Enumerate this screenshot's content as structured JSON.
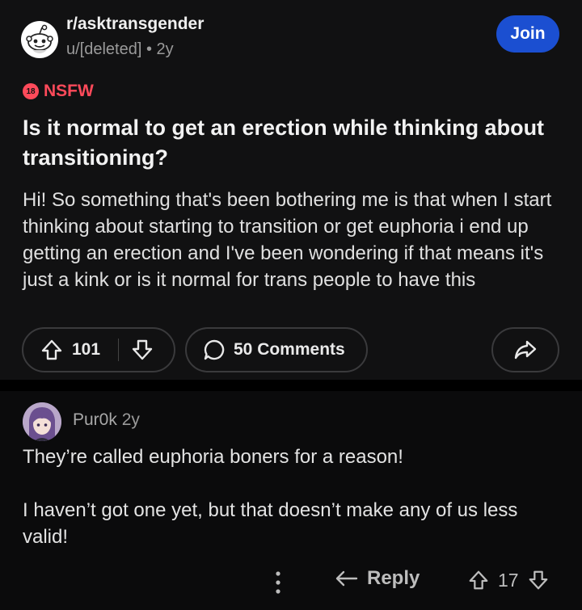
{
  "post": {
    "subreddit": "r/asktransgender",
    "author_meta": "u/[deleted] • 2y",
    "join_label": "Join",
    "nsfw_badge_icon_text": "18",
    "nsfw_label": "NSFW",
    "title": "Is it normal to get an erection while thinking about transitioning?",
    "body": "Hi! So something that's been bothering me is that when I start thinking about starting to transition or get euphoria i end up getting an erection and I've been wondering if that means it's just a kink or is it normal for trans people to have this",
    "upvotes": "101",
    "comments_label": "50 Comments",
    "icons": {
      "subreddit_avatar": "reddit-snoo-icon",
      "upvote": "arrow-up-icon",
      "downvote": "arrow-down-icon",
      "comments": "speech-bubble-icon",
      "share": "share-arrow-icon"
    }
  },
  "comment": {
    "author": "Pur0k",
    "age": "2y",
    "paragraphs": [
      "They’re called euphoria boners for a reason!",
      "I haven’t got one yet, but that doesn’t make any of us less valid!"
    ],
    "reply_label": "Reply",
    "votes": "17",
    "icons": {
      "more": "more-vertical-icon",
      "reply": "reply-arrow-icon",
      "upvote": "arrow-up-icon",
      "downvote": "arrow-down-icon"
    }
  },
  "colors": {
    "background": "#0b0b0c",
    "post_background": "#111112",
    "join_button": "#1b4fd1",
    "nsfw": "#ff4a5a"
  }
}
